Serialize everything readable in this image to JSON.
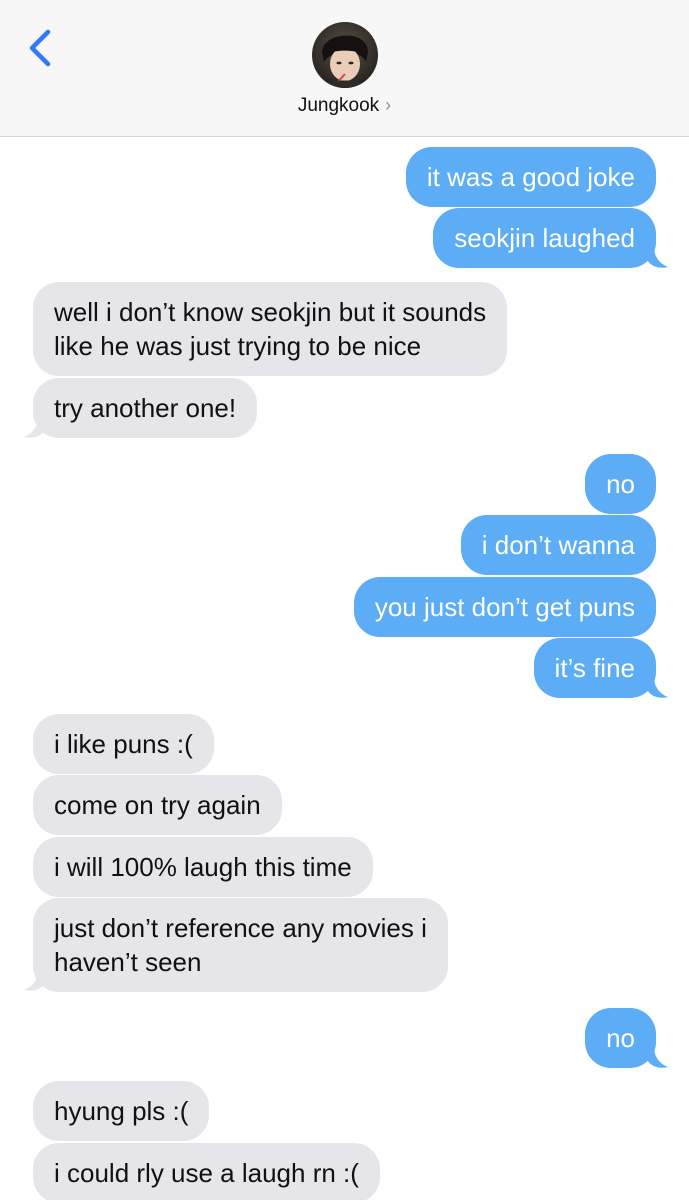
{
  "header": {
    "contact_name": "Jungkook",
    "chevron": "›",
    "back_icon": "chevron-left-icon",
    "accent": "#3478f6"
  },
  "colors": {
    "sent_bubble": "#5cadf5",
    "received_bubble": "#e5e5ea"
  },
  "messages": [
    {
      "from": "me",
      "text": "it was a good joke"
    },
    {
      "from": "me",
      "text": "seokjin laughed"
    },
    {
      "from": "them",
      "line1": "well i don’t know seokjin but it sounds",
      "line2": "like he was just trying to be nice"
    },
    {
      "from": "them",
      "text": "try another one!"
    },
    {
      "from": "me",
      "text": "no"
    },
    {
      "from": "me",
      "text": "i don’t wanna"
    },
    {
      "from": "me",
      "text": "you just don’t get puns"
    },
    {
      "from": "me",
      "text": "it’s fine"
    },
    {
      "from": "them",
      "text": "i like puns :("
    },
    {
      "from": "them",
      "text": "come on try again"
    },
    {
      "from": "them",
      "text": "i will 100% laugh this time"
    },
    {
      "from": "them",
      "line1": "just don’t reference any movies i",
      "line2": "haven’t seen"
    },
    {
      "from": "me",
      "text": "no"
    },
    {
      "from": "them",
      "text": "hyung pls :("
    },
    {
      "from": "them",
      "text": "i could rly use a laugh rn :("
    }
  ]
}
